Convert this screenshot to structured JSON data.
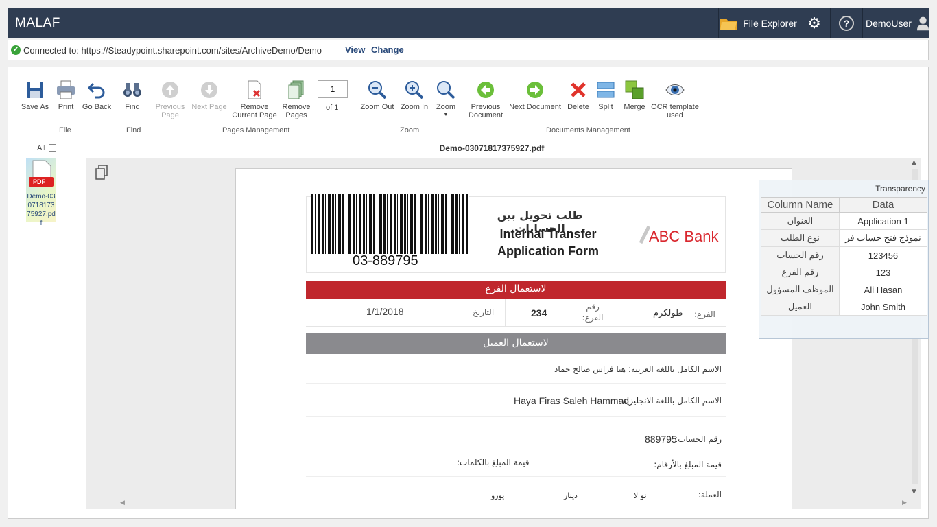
{
  "app": {
    "title": "MALAF",
    "file_explorer": "File Explorer",
    "user": "DemoUser"
  },
  "connection": {
    "label": "Connected to: https://Steadypoint.sharepoint.com/sites/ArchiveDemo/Demo",
    "view": "View",
    "change": "Change"
  },
  "ribbon": {
    "save_as": "Save As",
    "print": "Print",
    "go_back": "Go Back",
    "find": "Find",
    "previous_page": "Previous Page",
    "next_page": "Next Page",
    "remove_current_page": "Remove Current Page",
    "remove_pages": "Remove Pages",
    "page_number": "1",
    "page_of": "of 1",
    "zoom_out": "Zoom Out",
    "zoom_in": "Zoom In",
    "zoom": "Zoom",
    "previous_document": "Previous Document",
    "next_document": "Next Document",
    "delete": "Delete",
    "split": "Split",
    "merge": "Merge",
    "ocr_template": "OCR template used",
    "groups": {
      "file": "File",
      "find": "Find",
      "pages": "Pages Management",
      "zoom": "Zoom",
      "docs": "Documents Management"
    }
  },
  "sidebar": {
    "all_label": "All",
    "thumb_label": "Demo-03071817375927.pdf",
    "thumb_badge": "PDF"
  },
  "viewer": {
    "filename": "Demo-03071817375927.pdf"
  },
  "document": {
    "barcode_number": "03-889795",
    "title_ar": "طلب تحويل بين الحسابات",
    "title_en_1": "Internal Transfer",
    "title_en_2": "Application Form",
    "bank": "ABC Bank",
    "branch_band": "لاستعمال الفرع",
    "branch_label": "الفرع:",
    "branch_value": "طولكرم",
    "branch_no_label": "رقم الفرع:",
    "branch_no_value": "234",
    "date_label": "التاريخ",
    "date_value": "1/1/2018",
    "client_band": "لاستعمال العميل",
    "name_ar_line": "الاسم الكامل باللغة العربية: هيا فراس صالح حماد",
    "name_en_label": "الاسم الكامل باللغة الانجليزية:",
    "name_en_value": "Haya Firas Saleh Hammad",
    "account_label": "رقم الحساب:",
    "account_value": "889795",
    "amount_num_label": "قيمة المبلغ بالأرقام:",
    "amount_words_label": "قيمة المبلغ بالكلمات:",
    "currency_label": "العملة:",
    "currency_1": "نو لا",
    "currency_2": "دينار",
    "currency_3": "يورو"
  },
  "transparency": {
    "title": "Transparency",
    "col1": "Column Name",
    "col2": "Data",
    "rows": [
      {
        "name": "العنوان",
        "data": "Application 1"
      },
      {
        "name": "نوع الطلب",
        "data": "نموذج فتح حساب فر"
      },
      {
        "name": "رقم الحساب",
        "data": "123456"
      },
      {
        "name": "رقم الفرع",
        "data": "123"
      },
      {
        "name": "الموظف المسؤول",
        "data": "Ali Hasan"
      },
      {
        "name": "العميل",
        "data": "John Smith"
      }
    ]
  },
  "colors": {
    "titlebar": "#2f3d52",
    "accent_red": "#c0272d",
    "band_gray": "#8a8a8e",
    "bank_red": "#d9272e"
  }
}
